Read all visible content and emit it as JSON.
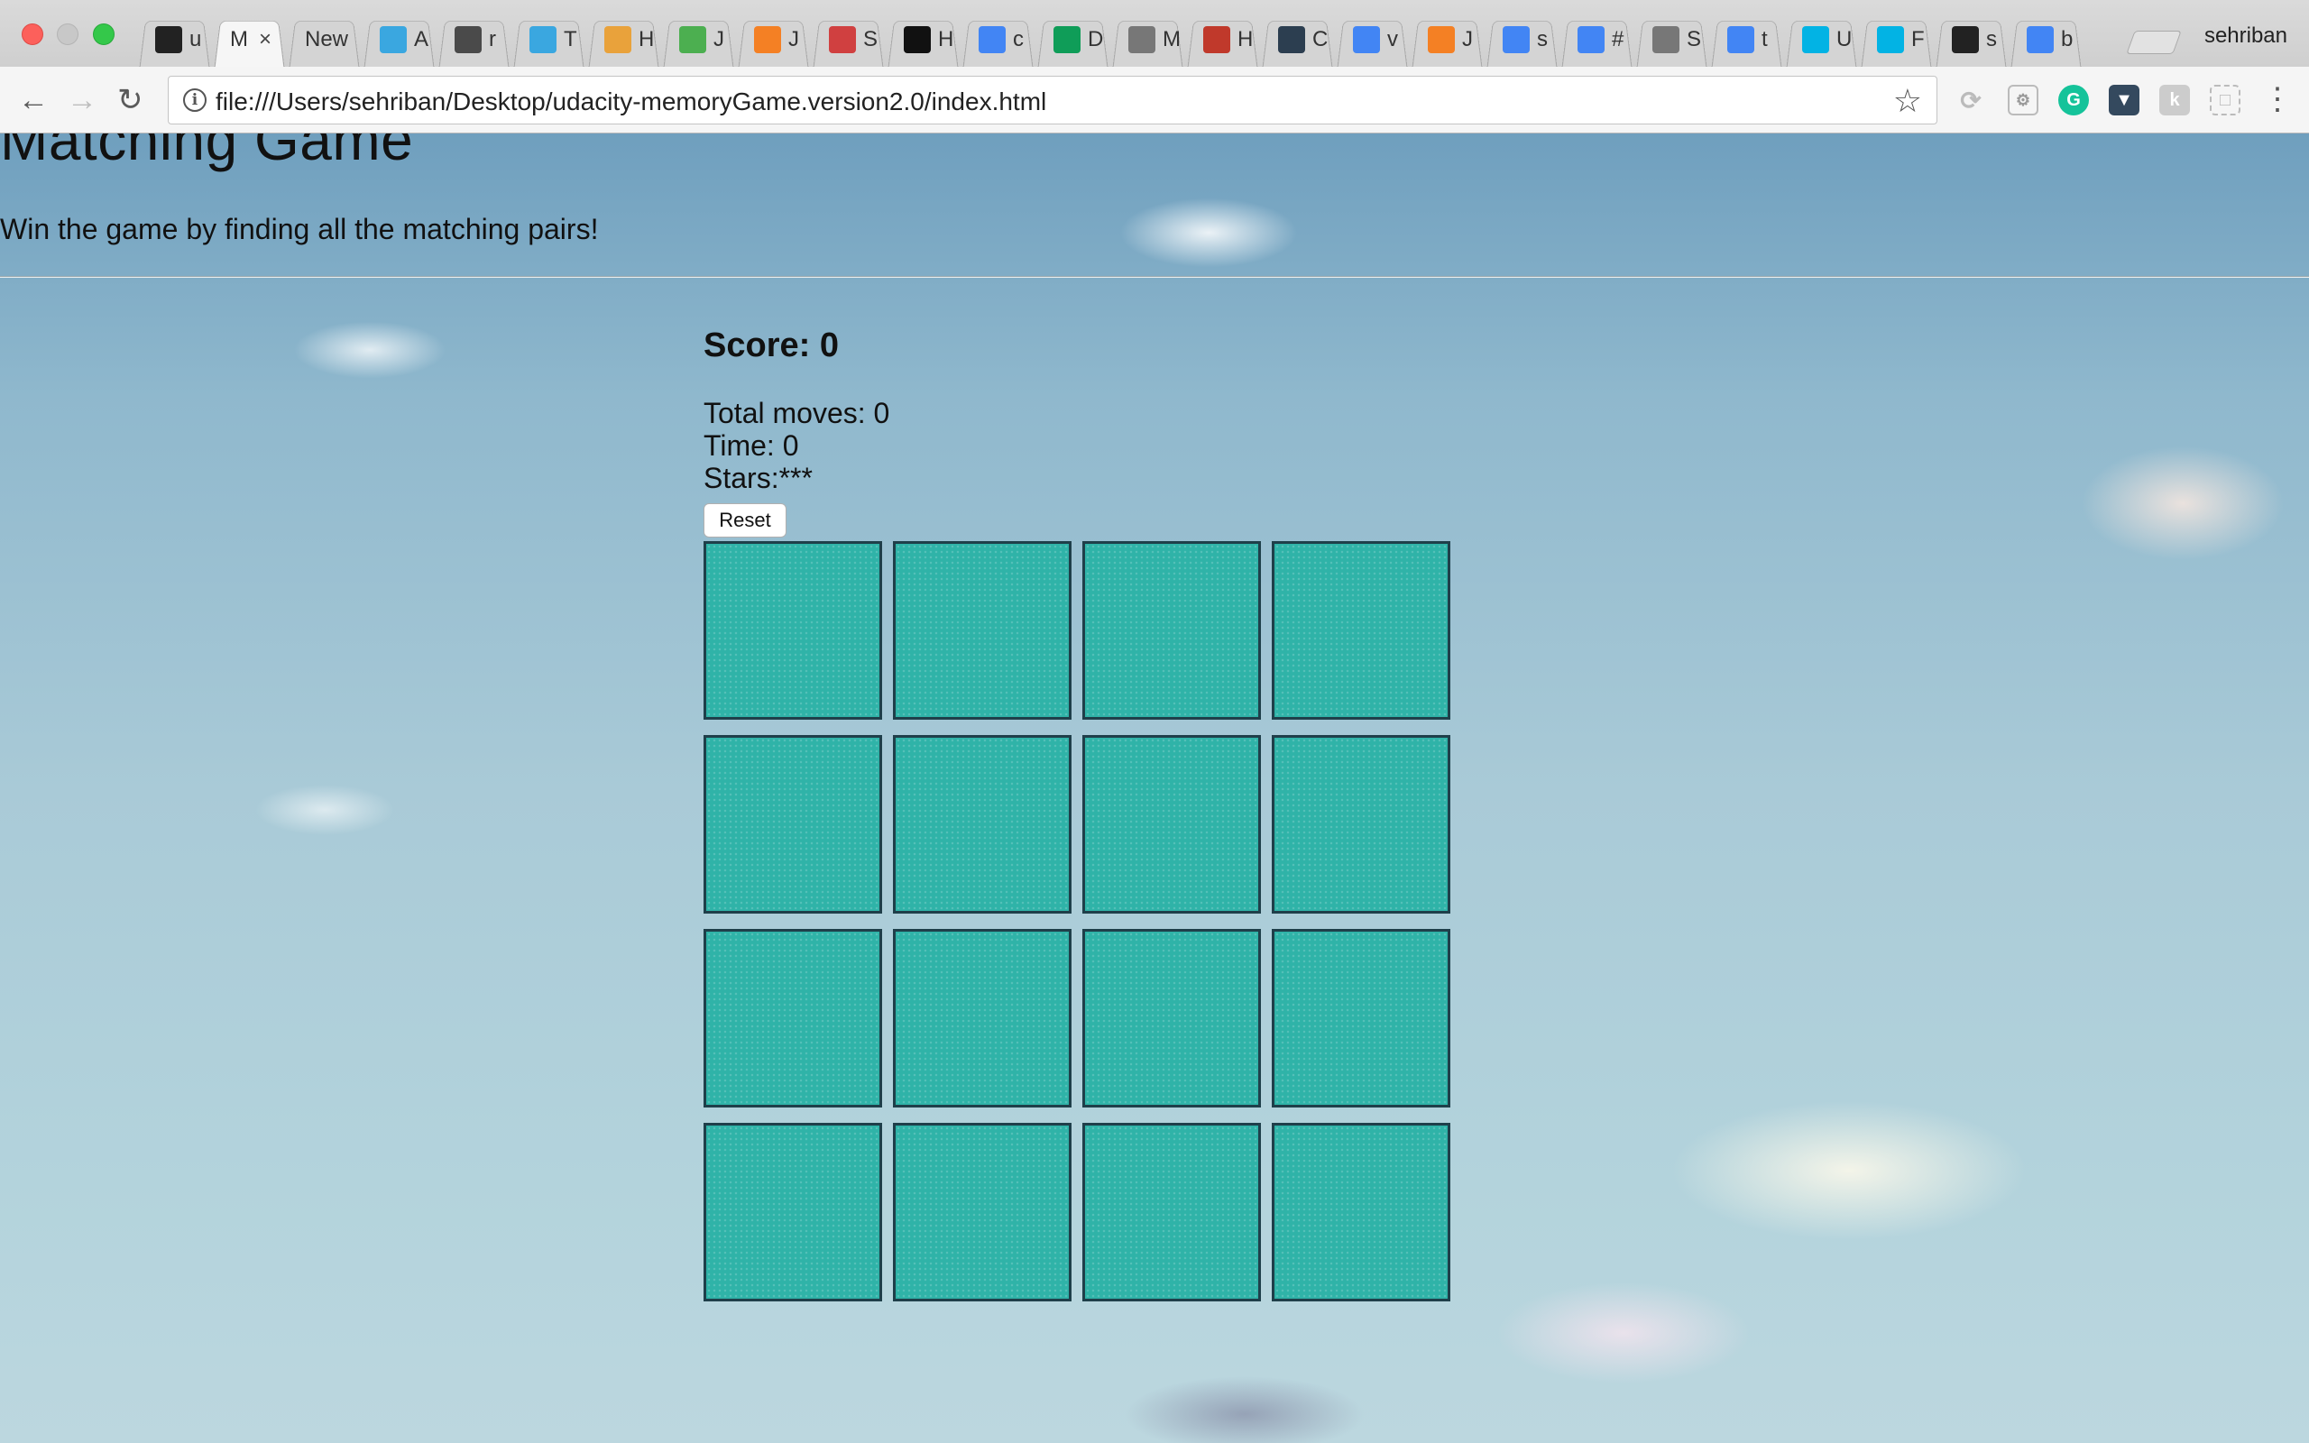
{
  "browser": {
    "tabs": [
      {
        "label": "u",
        "icon": "github-icon",
        "color": "#222222"
      },
      {
        "label": "M",
        "icon": "",
        "color": "",
        "active": true
      },
      {
        "label": "New",
        "icon": "",
        "color": ""
      },
      {
        "label": "A",
        "icon": "bird-icon",
        "color": "#3aa7e0"
      },
      {
        "label": "r",
        "icon": "swirl-icon",
        "color": "#4a4a4a"
      },
      {
        "label": "T",
        "icon": "bird-icon",
        "color": "#3aa7e0"
      },
      {
        "label": "H",
        "icon": "chrome-icon",
        "color": "#e9a23b"
      },
      {
        "label": "J",
        "icon": "w3-icon",
        "color": "#4caf50"
      },
      {
        "label": "J",
        "icon": "stackoverflow-icon",
        "color": "#f48024"
      },
      {
        "label": "S",
        "icon": "sa-icon",
        "color": "#d04040"
      },
      {
        "label": "H",
        "icon": "udacity-u-icon",
        "color": "#111111"
      },
      {
        "label": "c",
        "icon": "google-icon",
        "color": "#4285f4"
      },
      {
        "label": "D",
        "icon": "sheets-icon",
        "color": "#0f9d58"
      },
      {
        "label": "M",
        "icon": "document-icon",
        "color": "#777777"
      },
      {
        "label": "H",
        "icon": "h-icon",
        "color": "#c0392b"
      },
      {
        "label": "C",
        "icon": "jf-icon",
        "color": "#2c3e50"
      },
      {
        "label": "v",
        "icon": "google-icon",
        "color": "#4285f4"
      },
      {
        "label": "J",
        "icon": "stackoverflow-icon",
        "color": "#f48024"
      },
      {
        "label": "s",
        "icon": "google-icon",
        "color": "#4285f4"
      },
      {
        "label": "#",
        "icon": "google-icon",
        "color": "#4285f4"
      },
      {
        "label": "S",
        "icon": "document-icon",
        "color": "#777777"
      },
      {
        "label": "t",
        "icon": "google-icon",
        "color": "#4285f4"
      },
      {
        "label": "U",
        "icon": "udacity-icon",
        "color": "#02b3e4"
      },
      {
        "label": "F",
        "icon": "udacity-icon",
        "color": "#02b3e4"
      },
      {
        "label": "s",
        "icon": "github-icon",
        "color": "#222222"
      },
      {
        "label": "b",
        "icon": "google-icon",
        "color": "#4285f4"
      }
    ],
    "profile_name": "sehriban",
    "url": "file:///Users/sehriban/Desktop/udacity-memoryGame.version2.0/index.html",
    "extensions": [
      "refresh-ext-icon",
      "react-ext-icon",
      "grammarly-icon",
      "pocket-ext-icon",
      "stamp-ext-icon",
      "capture-ext-icon"
    ]
  },
  "page": {
    "title": "Matching Game",
    "subtitle": "Win the game by finding all the matching pairs!",
    "score_text": "Score: 0",
    "moves_text": "Total moves: 0",
    "time_text": "Time: 0",
    "stars_text": "Stars:***",
    "reset_label": "Reset",
    "card_color": "#2fb3a8",
    "card_count": 16
  }
}
